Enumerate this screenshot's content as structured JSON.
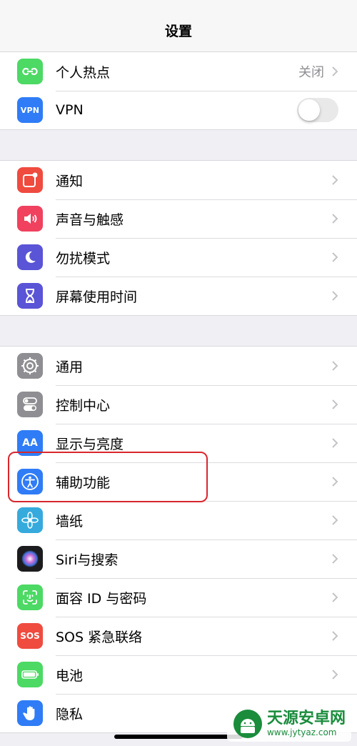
{
  "nav": {
    "title": "设置"
  },
  "groups": [
    {
      "items": [
        {
          "label": "个人热点",
          "value": "关闭",
          "icon": "hotspot-icon",
          "color": "#4cd964"
        },
        {
          "label": "VPN",
          "icon": "vpn-icon",
          "icon_text": "VPN",
          "color": "#2f7cf6",
          "toggle": false
        }
      ]
    },
    {
      "items": [
        {
          "label": "通知",
          "icon": "notification-icon",
          "color": "#ef4b3f"
        },
        {
          "label": "声音与触感",
          "icon": "sound-icon",
          "color": "#f0415f"
        },
        {
          "label": "勿扰模式",
          "icon": "moon-icon",
          "color": "#5a54d6"
        },
        {
          "label": "屏幕使用时间",
          "icon": "hourglass-icon",
          "color": "#5a54d6"
        }
      ]
    },
    {
      "items": [
        {
          "label": "通用",
          "icon": "gear-icon",
          "color": "#8e8e93"
        },
        {
          "label": "控制中心",
          "icon": "switches-icon",
          "color": "#8e8e93"
        },
        {
          "label": "显示与亮度",
          "icon": "display-icon",
          "icon_text": "AA",
          "color": "#2f7cf6"
        },
        {
          "label": "辅助功能",
          "icon": "accessibility-icon",
          "color": "#2f7cf6"
        },
        {
          "label": "墙纸",
          "icon": "wallpaper-icon",
          "color": "#36aadc"
        },
        {
          "label": "Siri与搜索",
          "icon": "siri-icon",
          "color": "#1c1c1e"
        },
        {
          "label": "面容 ID 与密码",
          "icon": "faceid-icon",
          "color": "#4cd964"
        },
        {
          "label": "SOS 紧急联络",
          "icon": "sos-icon",
          "icon_text": "SOS",
          "color": "#ef4b3f"
        },
        {
          "label": "电池",
          "icon": "battery-icon",
          "color": "#4cd964"
        },
        {
          "label": "隐私",
          "icon": "hand-icon",
          "color": "#2f7cf6"
        }
      ]
    }
  ],
  "highlight": {
    "target": "辅助功能",
    "color": "#d9262c"
  },
  "watermark": {
    "name": "天源安卓网",
    "url": "www.jytyaz.com",
    "color": "#1a8c3c"
  }
}
